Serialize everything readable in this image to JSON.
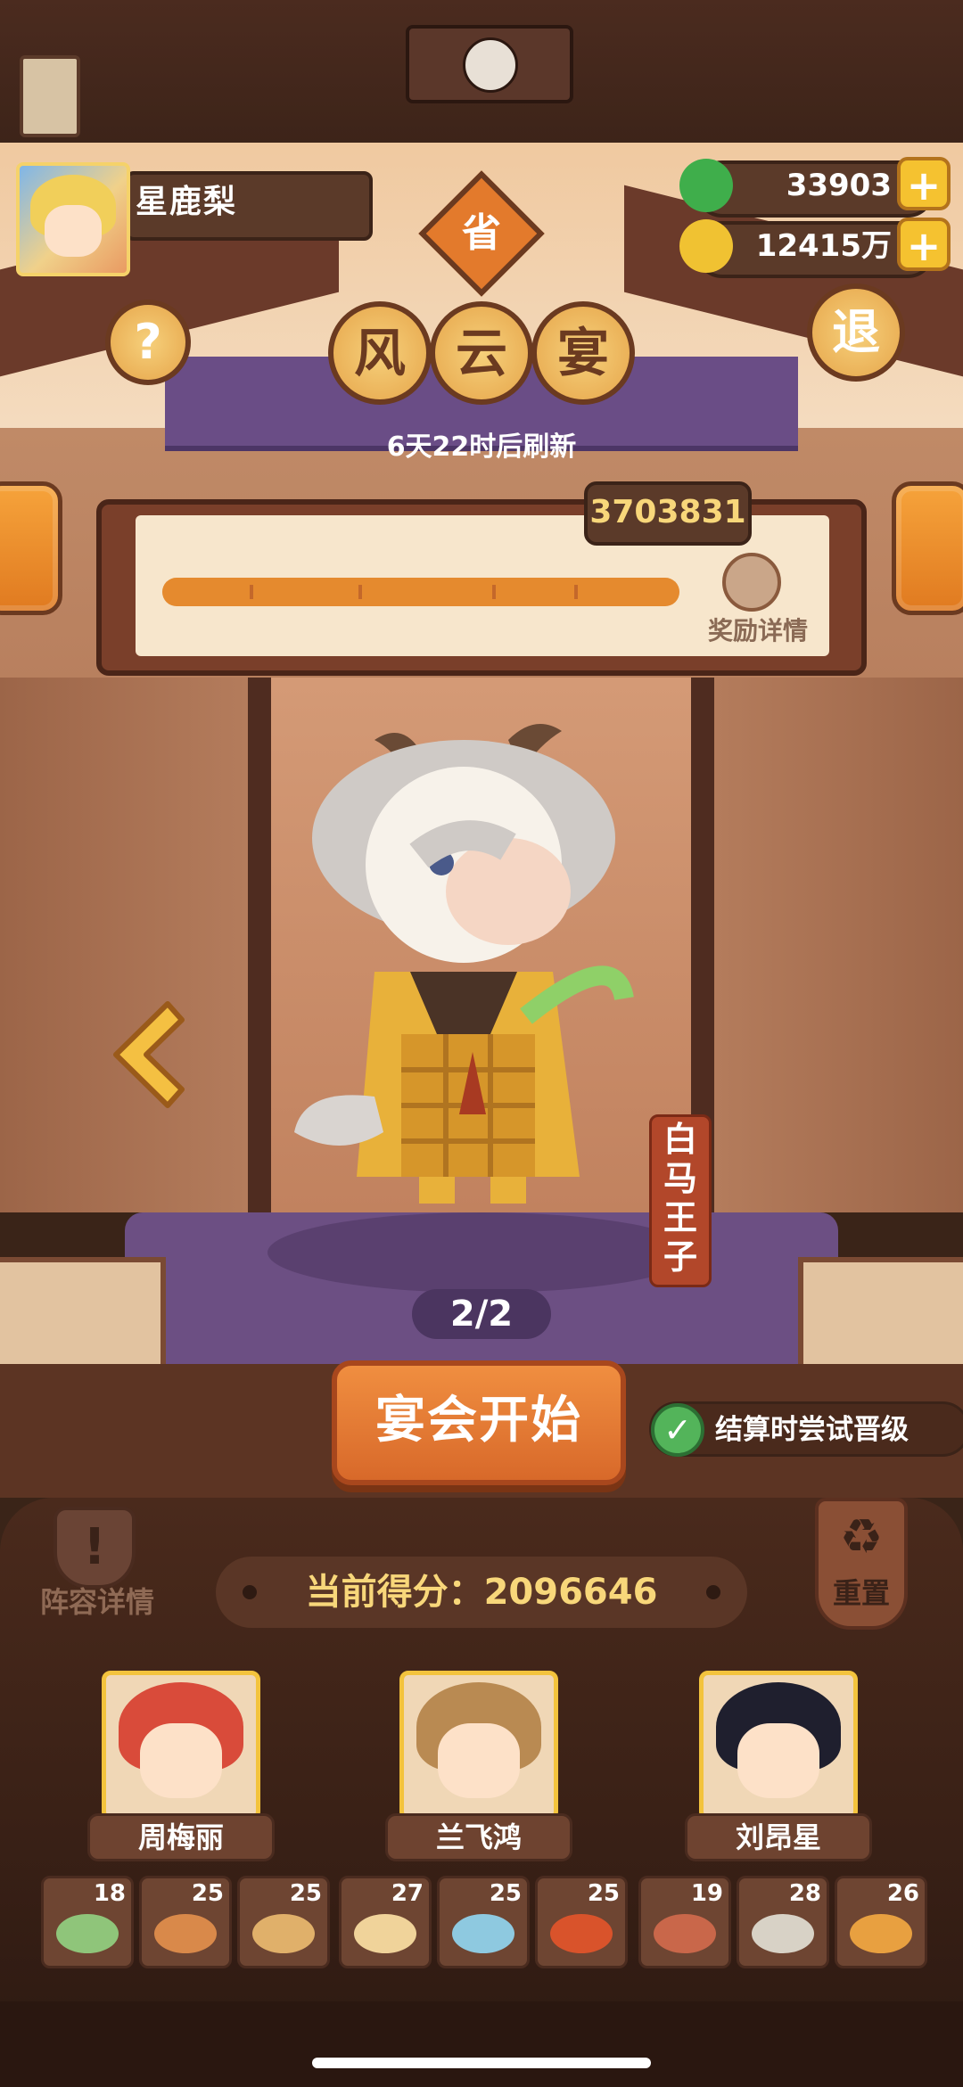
{
  "player": {
    "name": "星鹿梨"
  },
  "currencies": [
    {
      "name": "jade",
      "value": "33903",
      "color": "#3fae4b"
    },
    {
      "name": "gold-coin",
      "value": "12415万",
      "color": "#f0c232"
    }
  ],
  "header": {
    "rank_badge": "省",
    "title_chars": [
      "风",
      "云",
      "宴"
    ],
    "refresh_text": "6天22时后刷新",
    "help_label": "?",
    "exit_label": "退"
  },
  "progress": {
    "target_score": "3703831",
    "fill_fraction": 1.0,
    "reward_label": "奖励详情"
  },
  "character": {
    "name": "白马王子",
    "page": "2/2"
  },
  "actions": {
    "start_label": "宴会开始",
    "promo_label": "结算时尝试晋级",
    "promo_checked": true,
    "lineup_label": "阵容详情",
    "lineup_icon": "!",
    "reset_label": "重置"
  },
  "score": {
    "text": "当前得分：2096646"
  },
  "chefs": [
    {
      "name": "周梅丽",
      "hair_color": "#d94b3a"
    },
    {
      "name": "兰飞鸿",
      "hair_color": "#b98a52"
    },
    {
      "name": "刘昂星",
      "hair_color": "#1f1f2e"
    }
  ],
  "dishes": [
    {
      "level": "18",
      "color": "#8fc57a"
    },
    {
      "level": "25",
      "color": "#d9894a"
    },
    {
      "level": "25",
      "color": "#e0b06a"
    },
    {
      "level": "27",
      "color": "#f0d39a"
    },
    {
      "level": "25",
      "color": "#8ec9e0"
    },
    {
      "level": "25",
      "color": "#d9532b"
    },
    {
      "level": "19",
      "color": "#c9674a"
    },
    {
      "level": "28",
      "color": "#d8d2c6"
    },
    {
      "level": "26",
      "color": "#e8a040"
    }
  ]
}
